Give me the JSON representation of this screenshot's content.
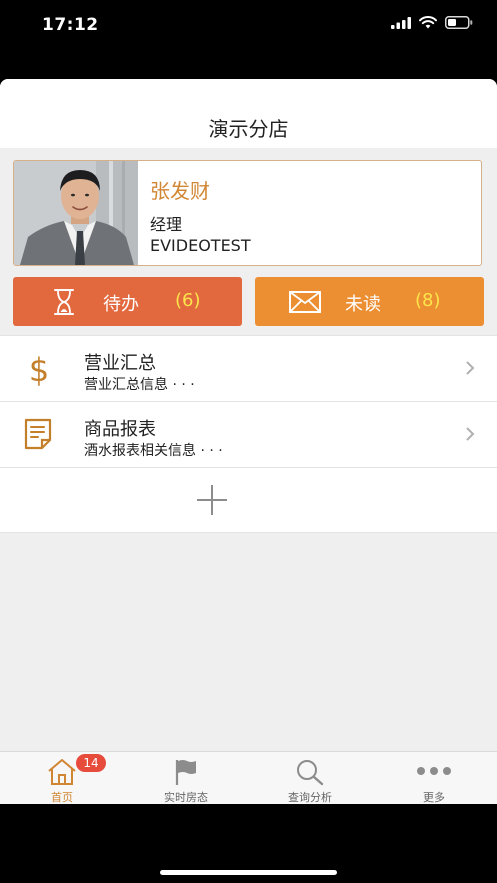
{
  "status": {
    "time": "17:12"
  },
  "header": {
    "title": "演示分店"
  },
  "profile": {
    "name": "张发财",
    "role": "经理",
    "store": "EVIDEOTEST"
  },
  "tiles": {
    "todo": {
      "label": "待办",
      "count": "(6)"
    },
    "unread": {
      "label": "未读",
      "count": "(8)"
    }
  },
  "menu": [
    {
      "title": "营业汇总",
      "subtitle": "营业汇总信息 · · ·",
      "icon": "dollar-icon"
    },
    {
      "title": "商品报表",
      "subtitle": "酒水报表相关信息 · · ·",
      "icon": "report-icon"
    }
  ],
  "tabbar": {
    "items": [
      {
        "label": "首页",
        "icon": "home-icon",
        "active": true,
        "badge": "14"
      },
      {
        "label": "实时房态",
        "icon": "flag-icon"
      },
      {
        "label": "查询分析",
        "icon": "search-icon"
      },
      {
        "label": "更多",
        "icon": "more-icon"
      }
    ]
  },
  "colors": {
    "accent": "#d18634",
    "todo": "#e2693e",
    "unread": "#ec8e32",
    "count": "#fce54a",
    "badge": "#e64b3c"
  }
}
